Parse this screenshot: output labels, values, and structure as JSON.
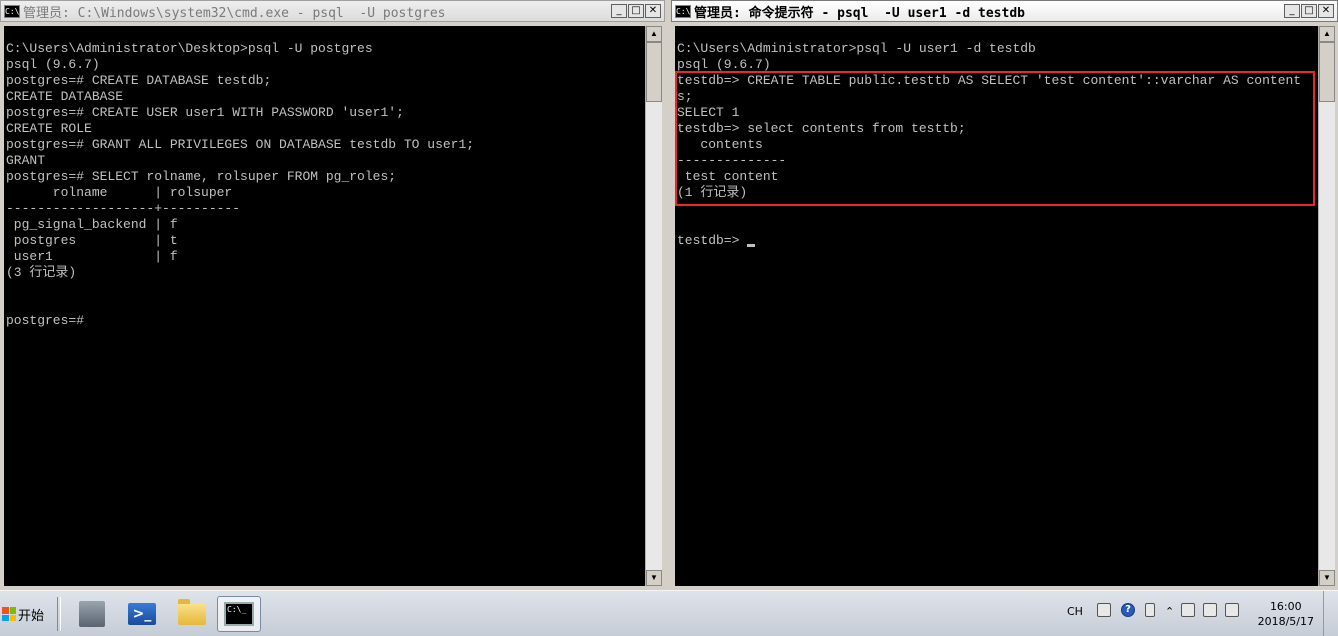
{
  "left_window": {
    "title": "管理员: C:\\Windows\\system32\\cmd.exe - psql  -U postgres",
    "icon_label": "C:\\",
    "lines": [
      "C:\\Users\\Administrator\\Desktop>psql -U postgres",
      "psql (9.6.7)",
      "postgres=# CREATE DATABASE testdb;",
      "CREATE DATABASE",
      "postgres=# CREATE USER user1 WITH PASSWORD 'user1';",
      "CREATE ROLE",
      "postgres=# GRANT ALL PRIVILEGES ON DATABASE testdb TO user1;",
      "GRANT",
      "postgres=# SELECT rolname, rolsuper FROM pg_roles;",
      "      rolname      | rolsuper",
      "-------------------+----------",
      " pg_signal_backend | f",
      " postgres          | t",
      " user1             | f",
      "(3 行记录)",
      "",
      "",
      "postgres=#"
    ]
  },
  "right_window": {
    "title": "管理员: 命令提示符 - psql  -U user1 -d testdb",
    "icon_label": "C:\\",
    "lines": [
      "C:\\Users\\Administrator>psql -U user1 -d testdb",
      "psql (9.6.7)",
      "testdb=> CREATE TABLE public.testtb AS SELECT 'test content'::varchar AS content",
      "s;",
      "SELECT 1",
      "testdb=> select contents from testtb;",
      "   contents",
      "--------------",
      " test content",
      "(1 行记录)",
      "",
      "",
      "testdb=> "
    ]
  },
  "window_buttons": {
    "minimize": "_",
    "restore": "□",
    "close": "✕"
  },
  "taskbar": {
    "start_label": "开始",
    "apps": [
      {
        "name": "server-manager-icon"
      },
      {
        "name": "powershell-icon",
        "glyph": ">_"
      },
      {
        "name": "folder-icon"
      },
      {
        "name": "cmd-icon",
        "glyph": "C:\\_"
      }
    ],
    "language": "CH",
    "time": "16:00",
    "date": "2018/5/17"
  }
}
